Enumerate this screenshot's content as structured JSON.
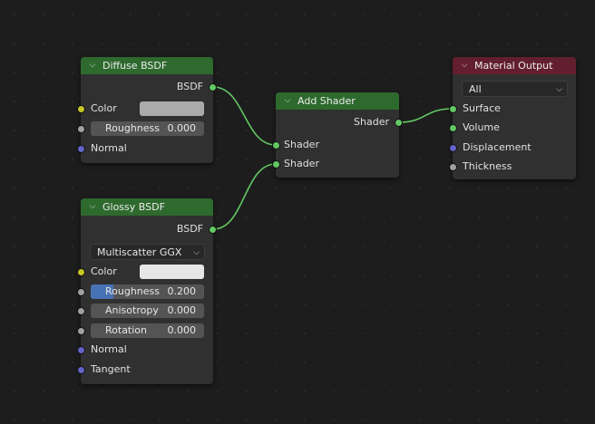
{
  "nodes": {
    "diffuse": {
      "title": "Diffuse BSDF",
      "output": "BSDF",
      "color_label": "Color",
      "color_value": "#ababab",
      "roughness_label": "Roughness",
      "roughness_value": "0.000",
      "normal_label": "Normal"
    },
    "glossy": {
      "title": "Glossy BSDF",
      "output": "BSDF",
      "distribution": "Multiscatter GGX",
      "color_label": "Color",
      "color_value": "#e6e6e6",
      "roughness_label": "Roughness",
      "roughness_value": "0.200",
      "roughness_fraction": 0.2,
      "anisotropy_label": "Anisotropy",
      "anisotropy_value": "0.000",
      "rotation_label": "Rotation",
      "rotation_value": "0.000",
      "normal_label": "Normal",
      "tangent_label": "Tangent"
    },
    "add_shader": {
      "title": "Add Shader",
      "output": "Shader",
      "input1": "Shader",
      "input2": "Shader"
    },
    "material_output": {
      "title": "Material Output",
      "target": "All",
      "surface": "Surface",
      "volume": "Volume",
      "displacement": "Displacement",
      "thickness": "Thickness"
    }
  },
  "colors": {
    "shader_header": "#2e6a2e",
    "output_header": "#631f2e",
    "shader_socket": "#63c763",
    "color_socket": "#c7c729",
    "float_socket": "#a1a1a1",
    "vector_socket": "#6363c7",
    "wire": "#63c763"
  },
  "icons": {
    "collapse": "chevron-down-icon",
    "dropdown": "chevron-down-icon"
  }
}
